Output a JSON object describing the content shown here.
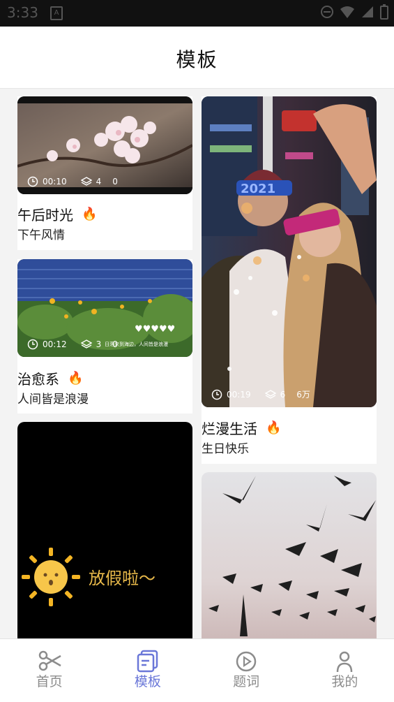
{
  "status_bar": {
    "time": "3:33"
  },
  "header": {
    "title": "模板"
  },
  "cards": [
    {
      "title": "午后时光",
      "subtitle": "下午风情",
      "duration": "00:10",
      "layers": "4",
      "count": "0"
    },
    {
      "title": "治愈系",
      "subtitle": "人间皆是浪漫",
      "duration": "00:12",
      "layers": "3",
      "count": "0"
    },
    {
      "title": "烂漫生活",
      "subtitle": "生日快乐",
      "duration": "00:19",
      "layers": "6",
      "count": "6万"
    },
    {
      "title": "",
      "subtitle": "",
      "overlay_text": "放假啦～"
    }
  ],
  "image_texts": {
    "glasses": "2021",
    "hearts": "♥♥♥♥♥",
    "caption": "日落来到海边，人间皆是浪漫"
  },
  "bottom_nav": {
    "items": [
      {
        "label": "首页",
        "icon": "scissors-icon"
      },
      {
        "label": "模板",
        "icon": "template-icon",
        "active": true
      },
      {
        "label": "题词",
        "icon": "play-circle-icon"
      },
      {
        "label": "我的",
        "icon": "person-icon"
      }
    ]
  },
  "colors": {
    "accent": "#6a77d8",
    "inactive": "#8c8c8c"
  }
}
